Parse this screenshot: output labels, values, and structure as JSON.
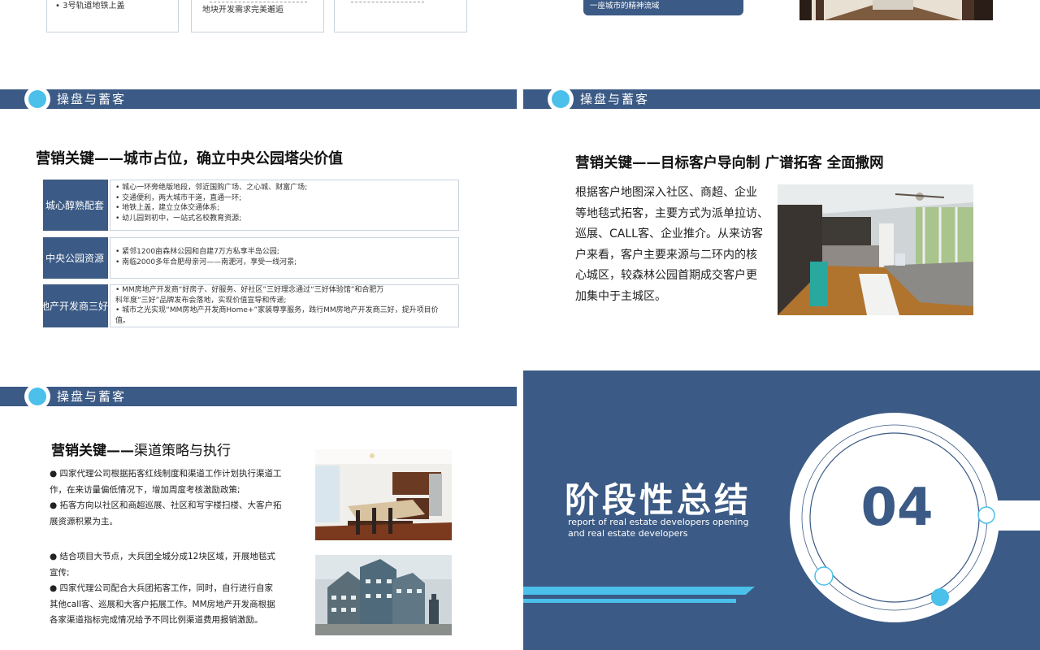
{
  "slide1": {
    "boxes": [
      {
        "text": "• 3号轨道地铁上盖"
      },
      {
        "text": "地块开发需求完美邂逅"
      },
      {
        "text": ""
      }
    ],
    "callout": "一座城市的精神流域"
  },
  "section_title": "操盘与蓄客",
  "slide2": {
    "title": "营销关键——城市占位，确立中央公园塔尖价值",
    "rows": [
      {
        "label": "城心醇熟配套",
        "lines": [
          "• 城心一环旁绝版地段，邻近国购广场、之心城、财富广场;",
          "• 交通便利，两大城市干道，直通一环;",
          "• 地铁上盖，建立立体交通体系;",
          "• 幼儿园到初中，一站式名校教育资源;"
        ]
      },
      {
        "label": "中央公园资源",
        "lines": [
          "• 紧邻1200亩森林公园和自建7万方私享半岛公园;",
          "• 南临2000多年合肥母亲河——南淝河，享受一线河景;"
        ]
      },
      {
        "label": "MM房地产开发商三好",
        "lines": [
          "• MM房地产开发商“好房子、好服务、好社区”三好理念通过“三好体验馆”和合肥万",
          "   科年度“三好”品牌发布会落地，实现价值宣导和传递;",
          "• 城市之光实现“MM房地产开发商Home+”家装尊享服务，践行MM房地产开发商三好，提升项目价",
          "   值。"
        ]
      }
    ]
  },
  "slide3": {
    "title": "营销关键——目标客户导向制  广谱拓客  全面撒网",
    "lines": [
      "根据客户地图深入社区、商超、企业",
      "等地毯式拓客，主要方式为派单拉访、",
      "巡展、CALL客、企业推介。从来访客",
      "户来看，客户主要来源与二环内的核",
      "心城区，较森林公园首期成交客户更",
      "加集中于主城区。"
    ]
  },
  "slide4": {
    "title_bold": "营销关键——",
    "title_rest": "渠道策略与执行",
    "block1": [
      "● 四家代理公司根据拓客红线制度和渠道工作计划执行渠道工",
      "作，在来访量偏低情况下，增加周度考核激励政策;",
      "● 拓客方向以社区和商超巡展、社区和写字楼扫楼、大客户拓",
      "展资源积累为主。"
    ],
    "block2": [
      "● 结合项目大节点，大兵团全城分成12块区域，开展地毯式",
      "宣传;",
      "● 四家代理公司配合大兵团拓客工作，同时，自行进行自家",
      "其他call客、巡展和大客户拓展工作。MM房地产开发商根据",
      "各家渠道指标完成情况给予不同比例渠道费用报销激励。"
    ]
  },
  "slide5": {
    "title": "阶段性总结",
    "subtitle_line1": "report of real estate developers opening",
    "subtitle_line2": "and real estate developers",
    "number": "04"
  },
  "colors": {
    "primary": "#3b5a85",
    "accent": "#4ac0ea",
    "border": "#c9d3df"
  }
}
